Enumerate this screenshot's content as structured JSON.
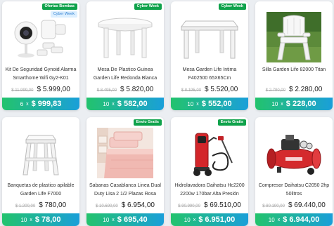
{
  "colors": {
    "accent_green": "#23c36d",
    "accent_blue": "#1a9fd9",
    "badge_green": "#0fa24b"
  },
  "products": [
    {
      "badges": [
        "Ofertas Bombas",
        "Cyber Week"
      ],
      "title": "Kit De Seguridad Gynoid Alarma Smarthome Wifi Gy2-K01",
      "old_price": "$ 11.999,00",
      "price": "$ 5.999,00",
      "installments_count": "6",
      "installments_x": "x",
      "installment_amount": "$ 999,83",
      "icon": "security-camera-kit-image"
    },
    {
      "badges": [
        "Cyber Week"
      ],
      "title": "Mesa De Plastico Guinea Garden Life Redonda Blanca",
      "old_price": "$ 8.495,00",
      "price": "$ 5.820,00",
      "installments_count": "10",
      "installments_x": "x",
      "installment_amount": "$ 582,00",
      "icon": "round-table-image"
    },
    {
      "badges": [
        "Cyber Week"
      ],
      "title": "Mesa Garden Life Intima F402500 65X65Cm",
      "old_price": "$ 8.195,00",
      "price": "$ 5.520,00",
      "installments_count": "10",
      "installments_x": "x",
      "installment_amount": "$ 552,00",
      "icon": "square-table-image"
    },
    {
      "badges": [],
      "title": "Silla Garden Life 82000 Titan",
      "old_price": "$ 2.790,00",
      "price": "$ 2.280,00",
      "installments_count": "10",
      "installments_x": "x",
      "installment_amount": "$ 228,00",
      "icon": "garden-chair-image"
    },
    {
      "badges": [],
      "title": "Banquetas de plastico apilable Garden Life F7000",
      "old_price": "$ 1.200,00",
      "price": "$ 780,00",
      "installments_count": "10",
      "installments_x": "x",
      "installment_amount": "$ 78,00",
      "icon": "stool-image"
    },
    {
      "badges": [
        "Envío Gratis"
      ],
      "title": "Sabanas Casablanca Linea Dual Duty Lisa 2 1/2 Plazas Rosa",
      "old_price": "$ 10.690,00",
      "price": "$ 6.954,00",
      "installments_count": "10",
      "installments_x": "x",
      "installment_amount": "$ 695,40",
      "icon": "bed-sheets-image"
    },
    {
      "badges": [
        "Envío Gratis"
      ],
      "title": "Hidrolavadora Daihatsu Hc2200 2200w 170bar Alta Presión",
      "old_price": "$ 90.990,00",
      "price": "$ 69.510,00",
      "installments_count": "10",
      "installments_x": "x",
      "installment_amount": "$ 6.951,00",
      "icon": "pressure-washer-image"
    },
    {
      "badges": [],
      "title": "Compresor Daihatsu C2050 2hp 50litros",
      "old_price": "$ 80.190,00",
      "price": "$ 69.440,00",
      "installments_count": "10",
      "installments_x": "x",
      "installment_amount": "$ 6.944,00",
      "icon": "air-compressor-image"
    }
  ]
}
